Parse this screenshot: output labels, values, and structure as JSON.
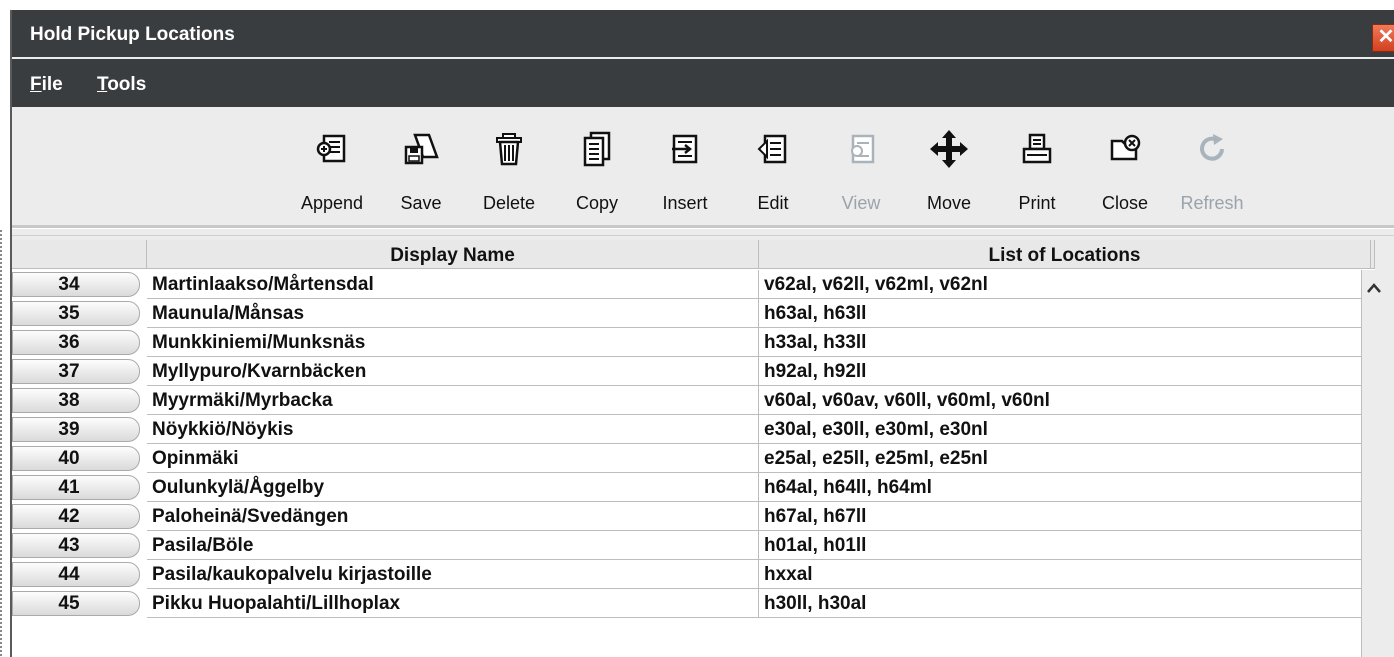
{
  "window": {
    "title": "Hold Pickup Locations",
    "close_glyph": "✕"
  },
  "menu": [
    {
      "label": "File",
      "accel": "F"
    },
    {
      "label": "Tools",
      "accel": "T"
    }
  ],
  "toolbar": [
    {
      "label": "Append",
      "icon": "append-icon",
      "enabled": true
    },
    {
      "label": "Save",
      "icon": "save-icon",
      "enabled": true
    },
    {
      "label": "Delete",
      "icon": "delete-icon",
      "enabled": true
    },
    {
      "label": "Copy",
      "icon": "copy-icon",
      "enabled": true
    },
    {
      "label": "Insert",
      "icon": "insert-icon",
      "enabled": true
    },
    {
      "label": "Edit",
      "icon": "edit-icon",
      "enabled": true
    },
    {
      "label": "View",
      "icon": "view-icon",
      "enabled": false
    },
    {
      "label": "Move",
      "icon": "move-icon",
      "enabled": true
    },
    {
      "label": "Print",
      "icon": "print-icon",
      "enabled": true
    },
    {
      "label": "Close",
      "icon": "close-icon",
      "enabled": true
    },
    {
      "label": "Refresh",
      "icon": "refresh-icon",
      "enabled": false
    }
  ],
  "table": {
    "columns": [
      "Display Name",
      "List of Locations"
    ],
    "rows": [
      {
        "num": "34",
        "name": "Martinlaakso/Mårtensdal",
        "locations": "v62al, v62ll, v62ml, v62nl"
      },
      {
        "num": "35",
        "name": "Maunula/Månsas",
        "locations": "h63al, h63ll"
      },
      {
        "num": "36",
        "name": "Munkkiniemi/Munksnäs",
        "locations": "h33al, h33ll"
      },
      {
        "num": "37",
        "name": "Myllypuro/Kvarnbäcken",
        "locations": "h92al, h92ll"
      },
      {
        "num": "38",
        "name": "Myyrmäki/Myrbacka",
        "locations": "v60al, v60av, v60ll, v60ml, v60nl"
      },
      {
        "num": "39",
        "name": "Nöykkiö/Nöykis",
        "locations": "e30al, e30ll, e30ml, e30nl"
      },
      {
        "num": "40",
        "name": "Opinmäki",
        "locations": "e25al, e25ll, e25ml, e25nl"
      },
      {
        "num": "41",
        "name": "Oulunkylä/Åggelby",
        "locations": "h64al, h64ll, h64ml"
      },
      {
        "num": "42",
        "name": "Paloheinä/Svedängen",
        "locations": "h67al, h67ll"
      },
      {
        "num": "43",
        "name": "Pasila/Böle",
        "locations": "h01al, h01ll"
      },
      {
        "num": "44",
        "name": "Pasila/kaukopalvelu kirjastoille",
        "locations": "hxxal"
      },
      {
        "num": "45",
        "name": "Pikku Huopalahti/Lillhoplax",
        "locations": "h30ll, h30al"
      }
    ]
  },
  "scrollbar": {
    "up_glyph": "^"
  },
  "colors": {
    "titlebar": "#3a3d3f",
    "toolbar_bg": "#ececec",
    "disabled_label": "#9aa3ab",
    "close_button": "#d2401e"
  }
}
